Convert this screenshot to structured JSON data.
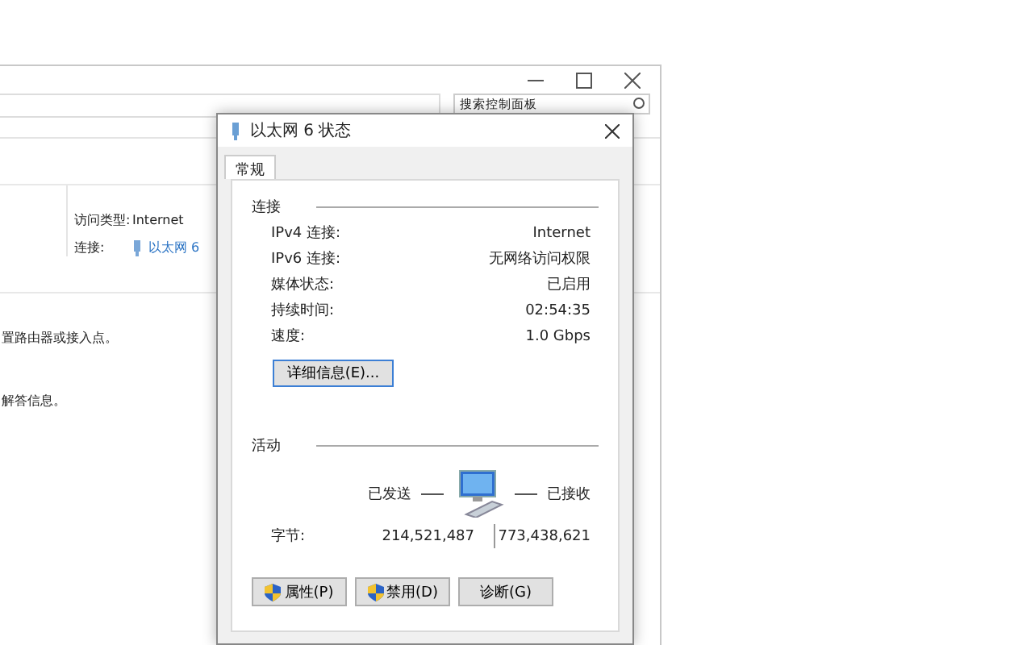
{
  "background_window": {
    "search": {
      "placeholder": "搜索控制面板"
    },
    "access_type": {
      "label": "访问类型:",
      "value": "Internet"
    },
    "connection": {
      "label": "连接:",
      "value": "以太网 6"
    },
    "text_lines": [
      "置路由器或接入点。",
      "解答信息。"
    ]
  },
  "dialog": {
    "title": "以太网 6 状态",
    "tabs": [
      {
        "label": "常规",
        "selected": true
      }
    ],
    "connection_section": {
      "heading": "连接",
      "rows": [
        {
          "label": "IPv4 连接:",
          "value": "Internet"
        },
        {
          "label": "IPv6 连接:",
          "value": "无网络访问权限"
        },
        {
          "label": "媒体状态:",
          "value": "已启用"
        },
        {
          "label": "持续时间:",
          "value": "02:54:35"
        },
        {
          "label": "速度:",
          "value": "1.0 Gbps"
        }
      ],
      "details_button": "详细信息(E)..."
    },
    "activity_section": {
      "heading": "活动",
      "sent_label": "已发送",
      "received_label": "已接收",
      "bytes_label": "字节:",
      "bytes_sent": "214,521,487",
      "bytes_received": "773,438,621"
    },
    "buttons": [
      {
        "label": "属性(P)",
        "shield": true
      },
      {
        "label": "禁用(D)",
        "shield": true
      },
      {
        "label": "诊断(G)",
        "shield": false
      }
    ]
  }
}
